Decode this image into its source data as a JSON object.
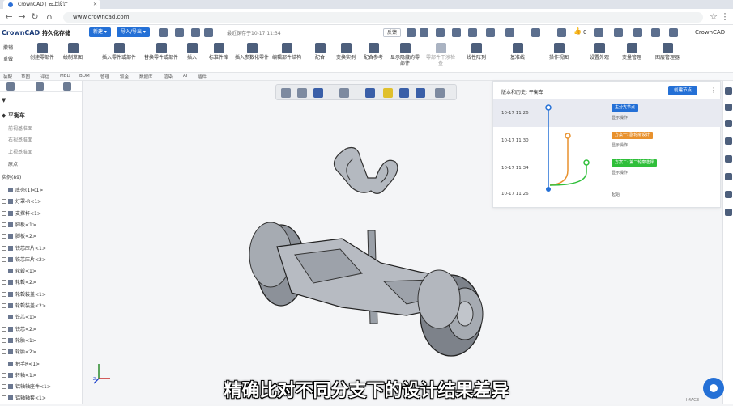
{
  "browser": {
    "tab_title": "CrownCAD | 云上设计",
    "url": "www.crowncad.com"
  },
  "app": {
    "logo": "CrownCAD",
    "project": "持久化存储",
    "new_btn": "新建 ▾",
    "import_btn": "导入/导出 ▾",
    "save_status": "最近保存于10-17 11:34",
    "version_label": "反馈",
    "user": "CrownCAD",
    "likes": "0"
  },
  "toolbar": {
    "undo": "撤销",
    "redo": "重做",
    "sketch_part": "创建零部件",
    "draw_sketch": "绘制草图",
    "insert_part": "插入零件或部件",
    "replace": "替换零件或部件",
    "insert": "插入",
    "std": "标准件库",
    "insert_param": "插入参数化零件",
    "edit": "编辑部件结构",
    "fit": "配合",
    "replace_inst": "变换实例",
    "ref": "配合参考",
    "show_hidden": "显示隐藏的零部件",
    "clash": "零部件干涉检查",
    "linear": "线性阵列",
    "basic": "基准线",
    "view": "操作视图",
    "set_look": "设置外观",
    "var": "变量管理",
    "layer": "图层管理器"
  },
  "subtabs": [
    "装配",
    "草图",
    "评估",
    "MBD",
    "BOM",
    "管理",
    "钣金",
    "数据库",
    "渲染",
    "AI",
    "插件"
  ],
  "tree": {
    "root": "平衡车",
    "planes": [
      "前视基准面",
      "右视基准面",
      "上视基准面",
      "原点"
    ],
    "instances_label": "实例(89)",
    "parts": [
      "底壳(1)<1>",
      "灯罩-R<1>",
      "支撑杆<1>",
      "脚板<1>",
      "脚板<2>",
      "铁芯压片<1>",
      "铁芯压片<2>",
      "轮毂<1>",
      "轮毂<2>",
      "轮毂装盖<1>",
      "轮毂装盖<2>",
      "铁芯<1>",
      "铁芯<2>",
      "轮胎<1>",
      "轮胎<2>",
      "把手R<1>",
      "转轴<1>",
      "铝轴轴座件<1>",
      "铝轴轴套<1>"
    ]
  },
  "history": {
    "header": "版本和历史: 平衡车",
    "create_btn": "创建节点",
    "rows": [
      {
        "time": "10-17 11:26",
        "label": "主分支节点",
        "color": "#2470d6",
        "sub": "显示操作"
      },
      {
        "time": "10-17 11:30",
        "label": "方案一: 副轮廓设计",
        "color": "#e8912d",
        "sub": "显示操作"
      },
      {
        "time": "10-17 11:34",
        "label": "方案二: 第二轮廓选择",
        "color": "#2fbf3a",
        "sub": "显示操作"
      },
      {
        "time": "10-17 11:26",
        "label": "",
        "color": "",
        "sub": "起始"
      }
    ]
  },
  "caption": "精确比对不同分支下的设计结果差异",
  "viewport": {
    "triad_label": "z",
    "watermark": "IMAGE"
  }
}
